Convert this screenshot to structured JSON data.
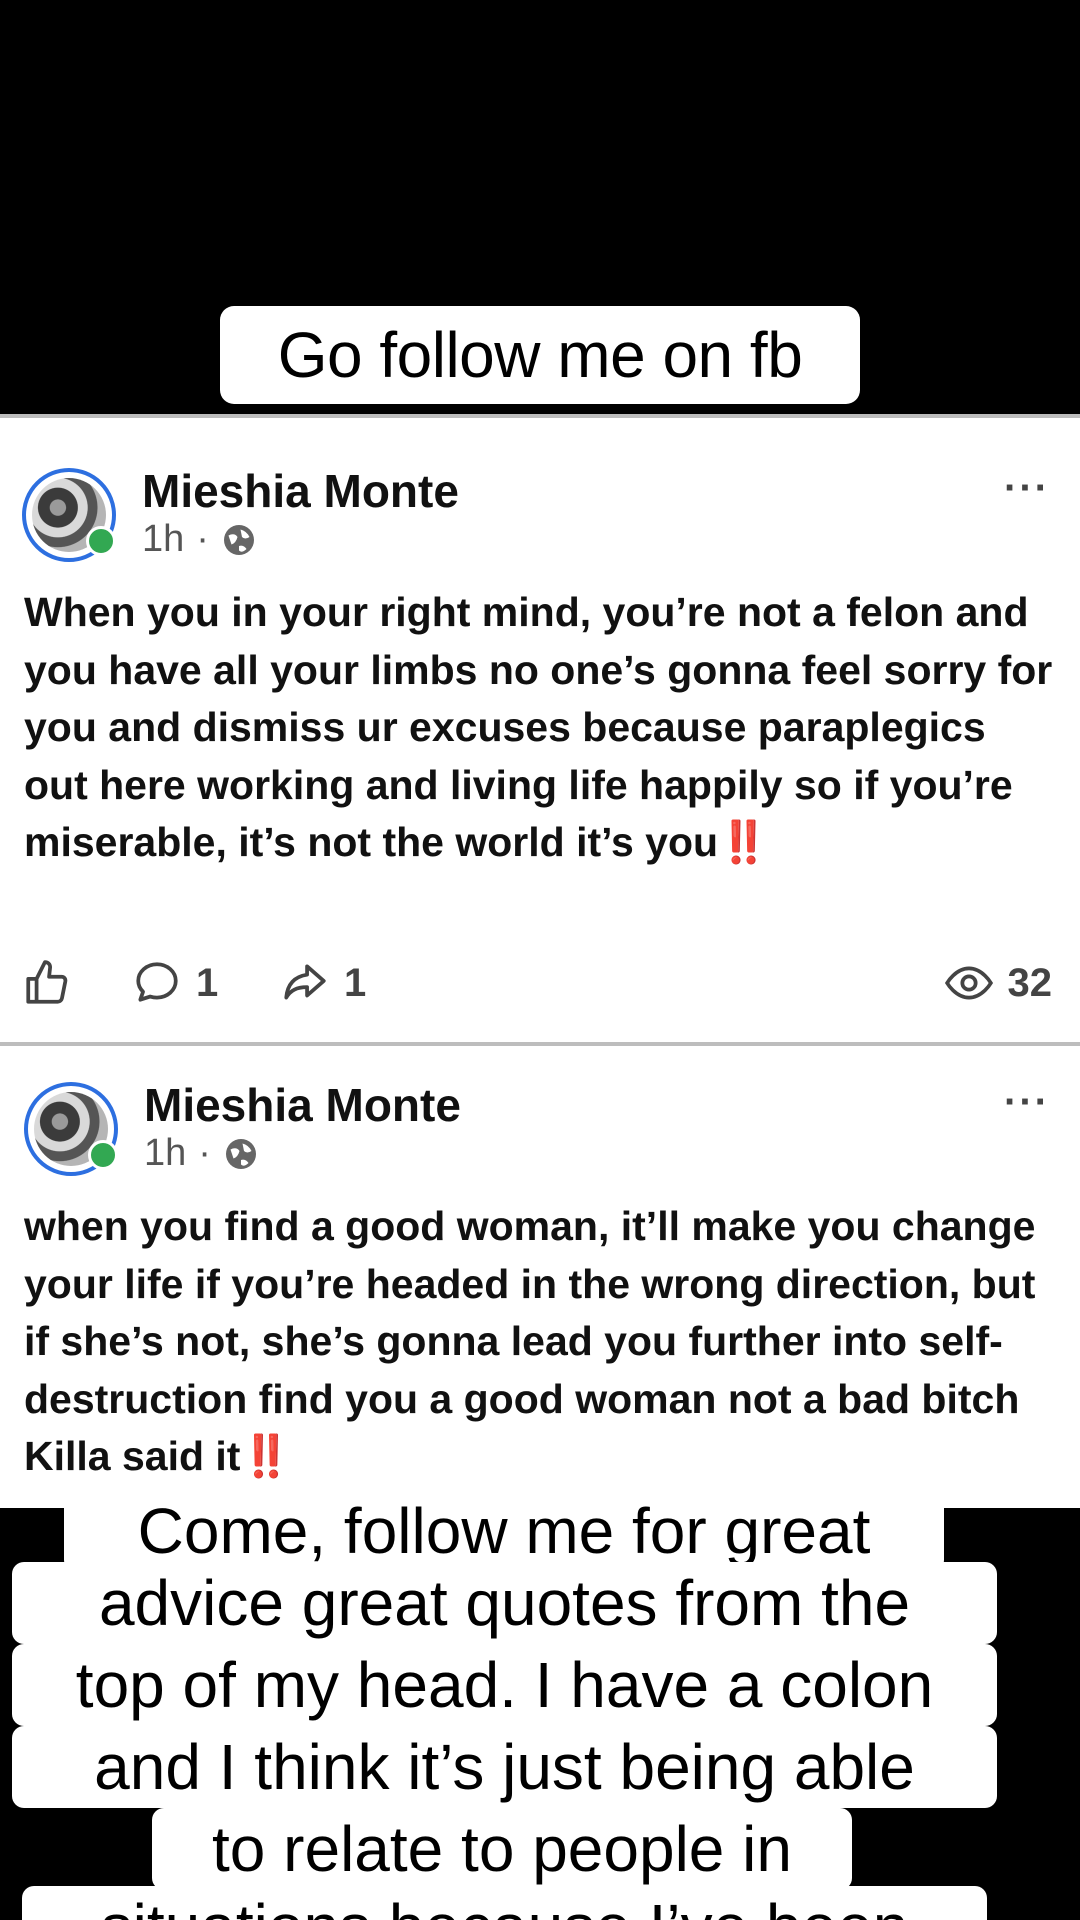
{
  "top_caption": "Go follow me on fb",
  "posts": [
    {
      "author": "Mieshia Monte",
      "time": "1h",
      "separator": "·",
      "text": "When you in your right mind, you’re not a felon and you have all your limbs no one’s gonna feel sorry for you and dismiss ur excuses because paraplegics out here working and living life happily so if you’re miserable, it’s not the world it’s you",
      "emphasis": "‼️",
      "comments": "1",
      "shares": "1",
      "views": "32",
      "more": "···"
    },
    {
      "author": "Mieshia Monte",
      "time": "1h",
      "separator": "·",
      "text": "when you find a good woman, it’ll make you change your life if you’re headed in the wrong direction, but if she’s not, she’s gonna lead you further into self-destruction find you a good woman not a bad bitch Killa said it",
      "emphasis": "‼️",
      "more": "···"
    }
  ],
  "bottom_caption": {
    "lines": [
      "Come, follow me for great",
      "advice great quotes from the",
      "top of my head. I have a colon",
      "and I think it’s just being able",
      "to relate to people in",
      "situations because I’ve been"
    ]
  },
  "icons": {
    "like": "thumbs-up-icon",
    "comment": "comment-bubble-icon",
    "share": "share-arrow-icon",
    "views": "eye-icon",
    "audience": "globe-icon",
    "more": "more-dots-icon"
  },
  "colors": {
    "avatar_ring": "#2d6fe0",
    "online": "#32a852",
    "emphasis": "#e01919"
  }
}
